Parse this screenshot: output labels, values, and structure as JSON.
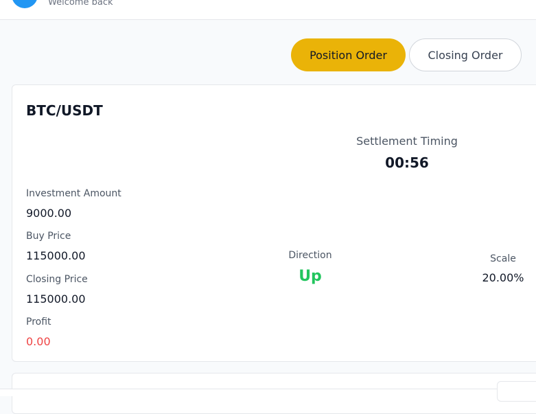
{
  "header": {
    "welcome_text": "Welcome back"
  },
  "tabs": {
    "position_order": "Position Order",
    "closing_order": "Closing Order"
  },
  "order_card": {
    "pair": "BTC/USDT",
    "settlement_label": "Settlement Timing",
    "settlement_value": "00:56",
    "investment_label": "Investment Amount",
    "investment_value": "9000.00",
    "buy_price_label": "Buy Price",
    "buy_price_value": "115000.00",
    "closing_price_label": "Closing Price",
    "closing_price_value": "115000.00",
    "profit_label": "Profit",
    "profit_value": "0.00",
    "direction_label": "Direction",
    "direction_value": "Up",
    "scale_label": "Scale",
    "scale_value": "20.00%"
  },
  "colors": {
    "accent": "#eab308",
    "avatar": "#2196f3",
    "up": "#22c55e",
    "profit": "#ef4444"
  }
}
